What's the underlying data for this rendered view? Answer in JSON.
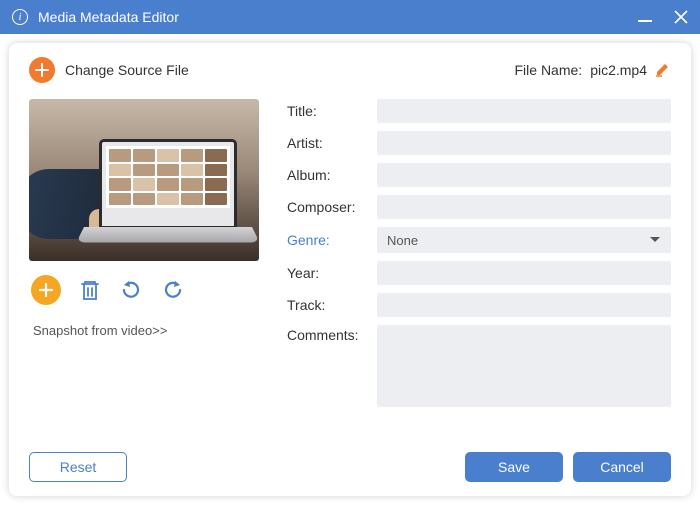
{
  "window": {
    "title": "Media Metadata Editor"
  },
  "top": {
    "change_source": "Change Source File",
    "file_name_label": "File Name:",
    "file_name_value": "pic2.mp4"
  },
  "snapshot_link": "Snapshot from video>>",
  "fields": {
    "title_label": "Title:",
    "artist_label": "Artist:",
    "album_label": "Album:",
    "composer_label": "Composer:",
    "genre_label": "Genre:",
    "year_label": "Year:",
    "track_label": "Track:",
    "comments_label": "Comments:",
    "title_value": "",
    "artist_value": "",
    "album_value": "",
    "composer_value": "",
    "genre_value": "None",
    "year_value": "",
    "track_value": "",
    "comments_value": ""
  },
  "buttons": {
    "reset": "Reset",
    "save": "Save",
    "cancel": "Cancel"
  }
}
